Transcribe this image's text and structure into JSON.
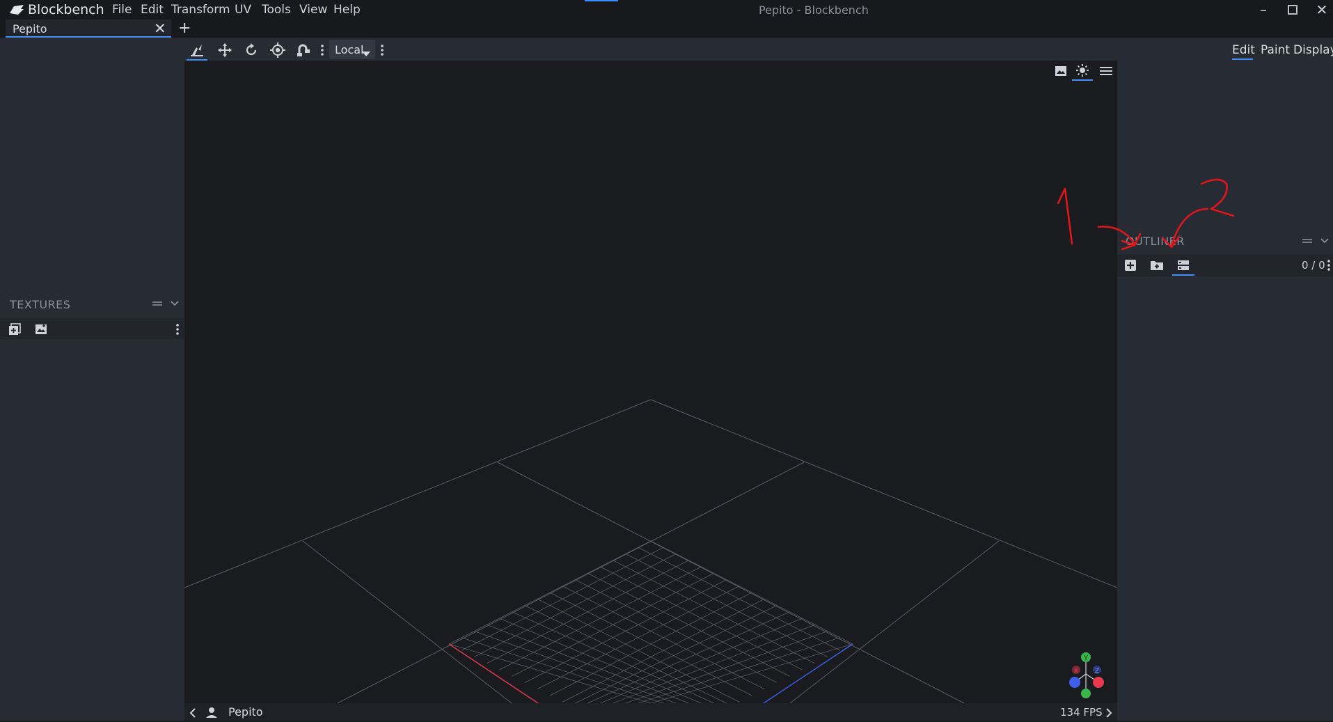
{
  "app": {
    "brand": "Blockbench",
    "window_title": "Pepito - Blockbench"
  },
  "menu": [
    "File",
    "Edit",
    "Transform",
    "UV",
    "Tools",
    "View",
    "Help"
  ],
  "tab": {
    "label": "Pepito"
  },
  "toolbar": {
    "tools": [
      "move-tool-icon",
      "resize-tool-icon",
      "rotate-tool-icon",
      "pivot-tool-icon",
      "vertex-snap-icon"
    ],
    "transform_space": "Local"
  },
  "modes": {
    "edit": "Edit",
    "paint": "Paint",
    "display": "Display"
  },
  "textures": {
    "title": "TEXTURES"
  },
  "outliner": {
    "title": "OUTLINER",
    "count": "0 / 0"
  },
  "statusbar": {
    "project": "Pepito",
    "fps": "134 FPS"
  },
  "annotations": {
    "label1": "1",
    "label2": "2"
  },
  "colors": {
    "accent": "#3e90ff",
    "annotation": "#e0161b",
    "axis_x": "#e8394e",
    "axis_y": "#39b54a",
    "axis_z": "#3f5fe8"
  }
}
